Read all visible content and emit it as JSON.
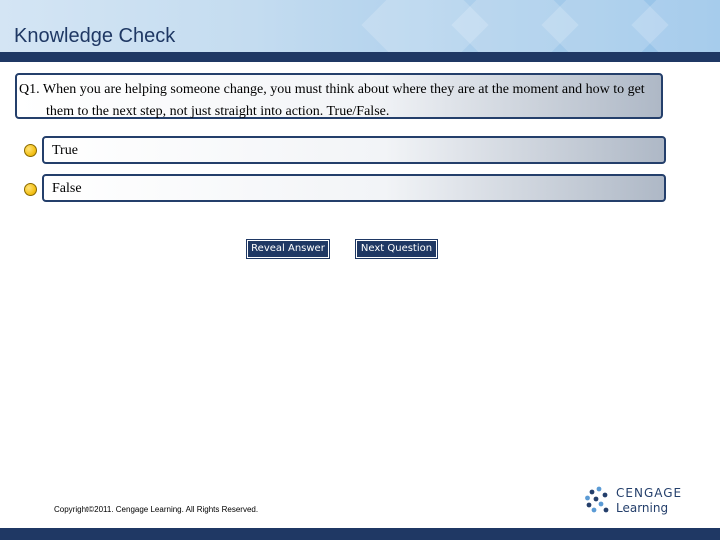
{
  "header": {
    "title": "Knowledge Check"
  },
  "question": {
    "text": "Q1. When you are helping someone change, you must think about where they are at the moment and how to get them to the next step, not just straight into action. True/False."
  },
  "options": [
    {
      "label": "True"
    },
    {
      "label": "False"
    }
  ],
  "buttons": {
    "reveal_label": "Reveal Answer",
    "next_label": "Next Question"
  },
  "footer": {
    "copyright": "Copyright©2011. Cengage Learning. All Rights Reserved."
  },
  "logo": {
    "line1": "CENGAGE",
    "line2": "Learning"
  },
  "colors": {
    "navy": "#1f3864",
    "radio": "#f4c21a",
    "header_light": "#d4e5f4"
  }
}
